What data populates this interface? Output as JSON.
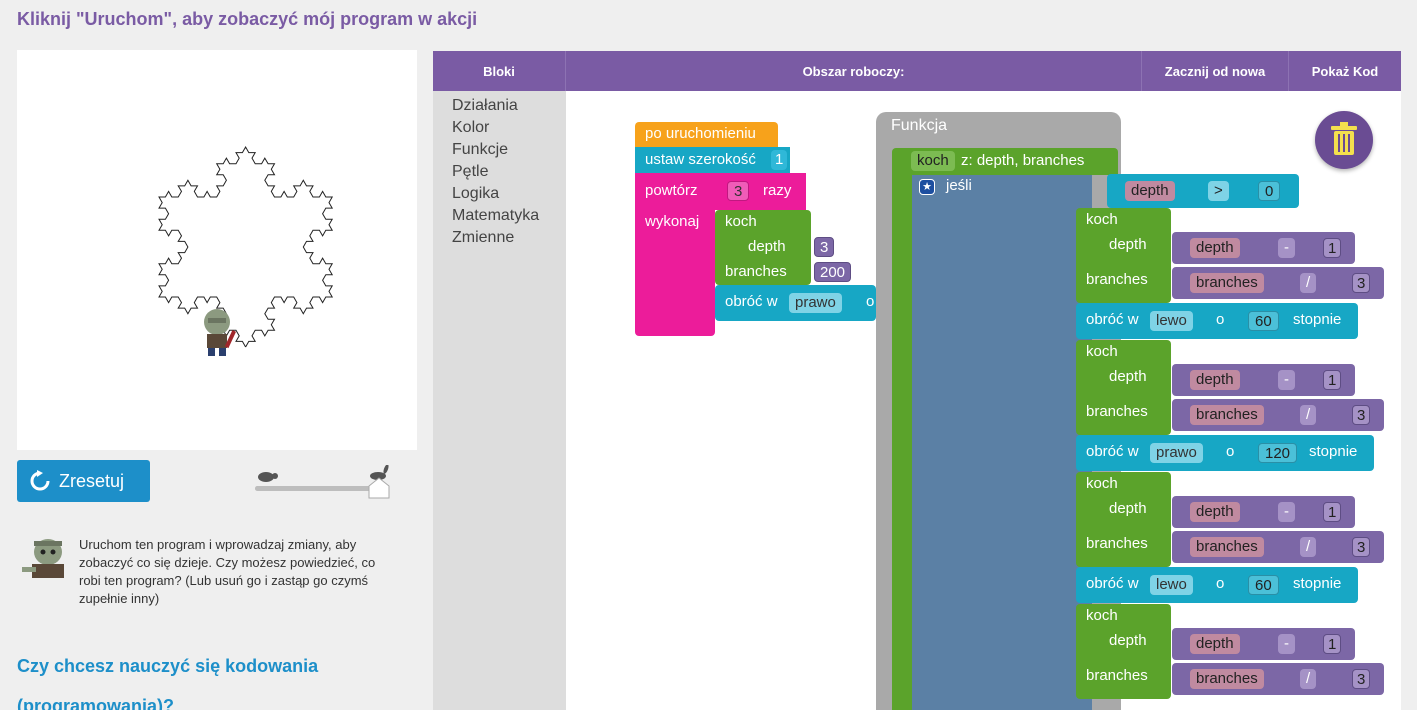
{
  "page_title": "Kliknij \"Uruchom\", aby zobaczyć mój program w akcji",
  "reset_label": "Zresetuj",
  "hint": "Uruchom ten program i wprowadzaj zmiany, aby zobaczyć co się dzieje. Czy możesz powiedzieć, co robi ten program? (Lub usuń go i zastąp go czymś zupełnie inny)",
  "promo": "Czy chcesz nauczyć się kodowania (programowania)?",
  "speed_level": 1.0,
  "header": {
    "blocks": "Bloki",
    "workspace": "Obszar roboczy:",
    "start_over": "Zacznij od nowa",
    "show_code": "Pokaż Kod"
  },
  "categories": [
    "Działania",
    "Kolor",
    "Funkcje",
    "Pętle",
    "Logika",
    "Matematyka",
    "Zmienne"
  ],
  "program": {
    "on_run": "po uruchomieniu",
    "set_width": "ustaw szerokość",
    "width_value": "1",
    "repeat": "powtórz",
    "repeat_count": "3",
    "times": "razy",
    "do": "wykonaj",
    "call_koch": "koch",
    "depth": "depth",
    "depth_value": "3",
    "branches": "branches",
    "branches_value": "200",
    "turn": "obróć w",
    "turn_dir": "prawo",
    "turn_o": "o"
  },
  "function_def": {
    "header": "Funkcja",
    "name": "koch",
    "params": "z: depth, branches",
    "if_label": "jeśli",
    "cond_var": "depth",
    "cond_op": ">",
    "cond_value": "0",
    "koch": "koch",
    "depth": "depth",
    "branches": "branches",
    "minus": "-",
    "divide": "/",
    "one": "1",
    "three": "3",
    "turn": "obróć w",
    "o": "o",
    "degrees": "stopnie",
    "turns": [
      {
        "dir": "lewo",
        "angle": "60"
      },
      {
        "dir": "prawo",
        "angle": "120"
      },
      {
        "dir": "lewo",
        "angle": "60"
      }
    ]
  },
  "colors": {
    "accent_purple": "#7a5ba4",
    "blue": "#1d8fc9",
    "event_orange": "#f7a21b",
    "teal": "#17a7c5",
    "loop_pink": "#ec1c9a",
    "function_green": "#5ba32b",
    "logic_blue": "#5b80a5",
    "math_purple": "#7c67a6"
  }
}
